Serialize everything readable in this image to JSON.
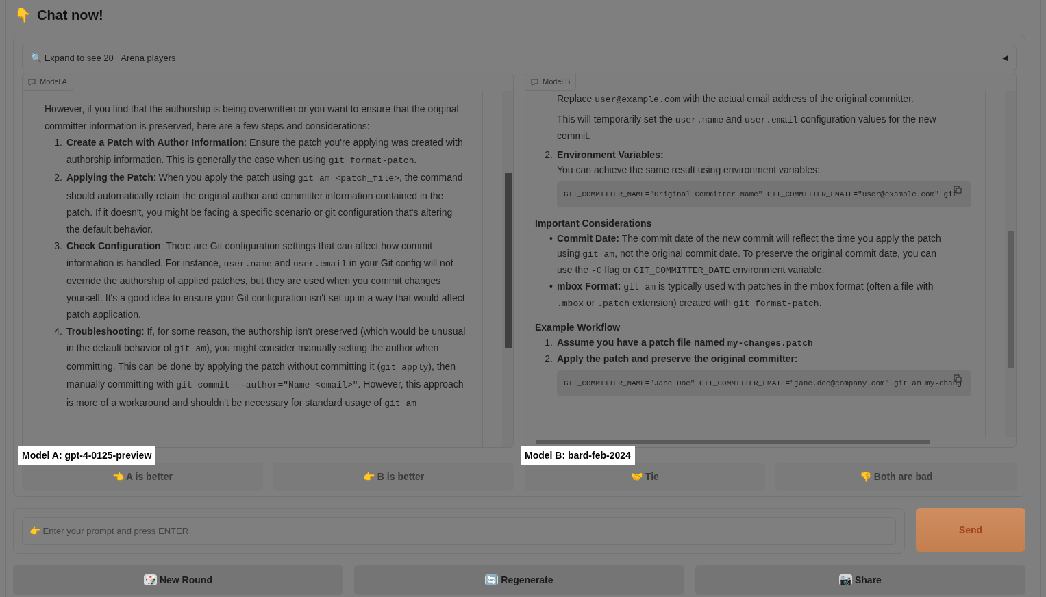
{
  "header": {
    "icon": "👇",
    "title": "Chat now!"
  },
  "accordion": {
    "icon": "🔍",
    "label": "Expand to see 20+ Arena players",
    "expanded": false,
    "toggle": "◀"
  },
  "panels": [
    {
      "tab": "Model A",
      "model_label": "Model A: gpt-4-0125-preview",
      "horizontal_scroll": false,
      "blocks": [
        {
          "kind": "para",
          "segs": [
            {
              "kind": "text",
              "text": "However, if you find that the authorship is being overwritten or you want to ensure that the original committer information is preserved, here are a few steps and considerations:"
            }
          ]
        },
        {
          "kind": "item",
          "marker": "1.",
          "segs": [
            {
              "kind": "bold",
              "text": "Create a Patch with Author Information"
            },
            {
              "kind": "text",
              "text": ": Ensure the patch you're applying was created with authorship information. This is generally the case when using "
            },
            {
              "kind": "code",
              "text": "git format-patch"
            },
            {
              "kind": "text",
              "text": "."
            }
          ]
        },
        {
          "kind": "item",
          "marker": "2.",
          "segs": [
            {
              "kind": "bold",
              "text": "Applying the Patch"
            },
            {
              "kind": "text",
              "text": ": When you apply the patch using "
            },
            {
              "kind": "code",
              "text": "git am <patch_file>"
            },
            {
              "kind": "text",
              "text": ", the command should automatically retain the original author and committer information contained in the patch. If it doesn't, you might be facing a specific scenario or git configuration that's altering the default behavior."
            }
          ]
        },
        {
          "kind": "item",
          "marker": "3.",
          "segs": [
            {
              "kind": "bold",
              "text": "Check Configuration"
            },
            {
              "kind": "text",
              "text": ": There are Git configuration settings that can affect how commit information is handled. For instance, "
            },
            {
              "kind": "code",
              "text": "user.name"
            },
            {
              "kind": "text",
              "text": " and "
            },
            {
              "kind": "code",
              "text": "user.email"
            },
            {
              "kind": "text",
              "text": " in your Git config will not override the authorship of applied patches, but they are used when you commit changes yourself. It's a good idea to ensure your Git configuration isn't set up in a way that would affect patch application."
            }
          ]
        },
        {
          "kind": "item",
          "marker": "4.",
          "segs": [
            {
              "kind": "bold",
              "text": "Troubleshooting"
            },
            {
              "kind": "text",
              "text": ": If, for some reason, the authorship isn't preserved (which would be unusual in the default behavior of "
            },
            {
              "kind": "code",
              "text": "git am"
            },
            {
              "kind": "text",
              "text": "), you might consider manually setting the author when committing. This can be done by applying the patch without committing it ("
            },
            {
              "kind": "code",
              "text": "git apply"
            },
            {
              "kind": "text",
              "text": "), then manually committing with "
            },
            {
              "kind": "code",
              "text": "git commit --author=\"Name <email>\""
            },
            {
              "kind": "text",
              "text": ". However, this approach is more of a workaround and shouldn't be necessary for standard usage of "
            },
            {
              "kind": "code",
              "text": "git am"
            }
          ]
        }
      ]
    },
    {
      "tab": "Model B",
      "model_label": "Model B: bard-feb-2024",
      "horizontal_scroll": true,
      "blocks": [
        {
          "kind": "cont",
          "segs": [
            {
              "kind": "text",
              "text": "Replace "
            },
            {
              "kind": "code",
              "text": "user@example.com"
            },
            {
              "kind": "text",
              "text": " with the actual email address of the original committer."
            }
          ]
        },
        {
          "kind": "cont",
          "segs": [
            {
              "kind": "text",
              "text": "This will temporarily set the "
            },
            {
              "kind": "code",
              "text": "user.name"
            },
            {
              "kind": "text",
              "text": " and "
            },
            {
              "kind": "code",
              "text": "user.email"
            },
            {
              "kind": "text",
              "text": " configuration values for the new commit."
            }
          ]
        },
        {
          "kind": "item",
          "marker": "2.",
          "segs": [
            {
              "kind": "bold",
              "text": "Environment Variables:"
            }
          ]
        },
        {
          "kind": "cont",
          "segs": [
            {
              "kind": "text",
              "text": "You can achieve the same result using environment variables:"
            }
          ]
        },
        {
          "kind": "code",
          "text": "GIT_COMMITTER_NAME=\"Original Committer Name\" GIT_COMMITTER_EMAIL=\"user@example.com\" git"
        },
        {
          "kind": "heading",
          "segs": [
            {
              "kind": "text",
              "text": "Important Considerations"
            }
          ]
        },
        {
          "kind": "item",
          "marker": "•",
          "segs": [
            {
              "kind": "bold",
              "text": "Commit Date:"
            },
            {
              "kind": "text",
              "text": " The commit date of the new commit will reflect the time you apply the patch using "
            },
            {
              "kind": "code",
              "text": "git am"
            },
            {
              "kind": "text",
              "text": ", not the original commit date. To preserve the original commit date, you can use the "
            },
            {
              "kind": "code",
              "text": "-C"
            },
            {
              "kind": "text",
              "text": " flag or "
            },
            {
              "kind": "code",
              "text": "GIT_COMMITTER_DATE"
            },
            {
              "kind": "text",
              "text": " environment variable."
            }
          ]
        },
        {
          "kind": "item",
          "marker": "•",
          "segs": [
            {
              "kind": "bold",
              "text": "mbox Format: "
            },
            {
              "kind": "code",
              "text": "git am"
            },
            {
              "kind": "text",
              "text": " is typically used with patches in the mbox format (often a file with "
            },
            {
              "kind": "code",
              "text": ".mbox"
            },
            {
              "kind": "text",
              "text": " or "
            },
            {
              "kind": "code",
              "text": ".patch"
            },
            {
              "kind": "text",
              "text": " extension) created with "
            },
            {
              "kind": "code",
              "text": "git format-patch"
            },
            {
              "kind": "text",
              "text": "."
            }
          ]
        },
        {
          "kind": "heading",
          "segs": [
            {
              "kind": "text",
              "text": "Example Workflow"
            }
          ]
        },
        {
          "kind": "item",
          "marker": "1.",
          "segs": [
            {
              "kind": "bold",
              "text": "Assume you have a patch file named "
            },
            {
              "kind": "boldcode",
              "text": "my-changes.patch"
            }
          ]
        },
        {
          "kind": "item",
          "marker": "2.",
          "segs": [
            {
              "kind": "bold",
              "text": "Apply the patch and preserve the original committer:"
            }
          ]
        },
        {
          "kind": "code",
          "text": "GIT_COMMITTER_NAME=\"Jane Doe\" GIT_COMMITTER_EMAIL=\"jane.doe@company.com\" git am my-chang"
        }
      ]
    }
  ],
  "votes": [
    {
      "icon": "👈",
      "label": "A is better",
      "disabled": true
    },
    {
      "icon": "👉",
      "label": "B is better",
      "disabled": true
    },
    {
      "icon": "🤝",
      "label": "Tie",
      "disabled": true
    },
    {
      "icon": "👎",
      "label": "Both are bad",
      "disabled": true
    }
  ],
  "prompt": {
    "placeholder": "👉 Enter your prompt and press ENTER"
  },
  "send": "Send",
  "actions": [
    {
      "icon": "🎲",
      "label": "New Round"
    },
    {
      "icon": "🔄",
      "label": "Regenerate"
    },
    {
      "icon": "📷",
      "label": "Share"
    }
  ]
}
